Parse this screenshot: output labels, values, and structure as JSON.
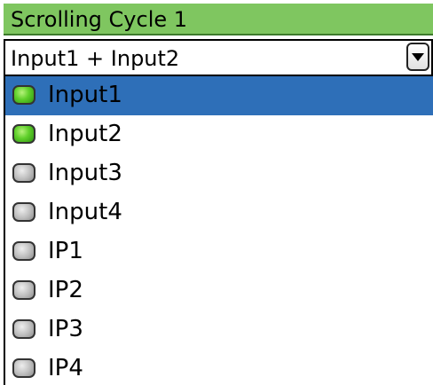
{
  "header": {
    "title": "Scrolling Cycle 1",
    "color": "#7fc660"
  },
  "combo": {
    "value": "Input1 + Input2",
    "arrow_icon": "chevron-down-icon"
  },
  "list": {
    "selected_color": "#2e6fb8",
    "items": [
      {
        "label": "Input1",
        "state": "on",
        "selected": true
      },
      {
        "label": "Input2",
        "state": "on",
        "selected": false
      },
      {
        "label": "Input3",
        "state": "off",
        "selected": false
      },
      {
        "label": "Input4",
        "state": "off",
        "selected": false
      },
      {
        "label": "IP1",
        "state": "off",
        "selected": false
      },
      {
        "label": "IP2",
        "state": "off",
        "selected": false
      },
      {
        "label": "IP3",
        "state": "off",
        "selected": false
      },
      {
        "label": "IP4",
        "state": "off",
        "selected": false
      }
    ]
  }
}
